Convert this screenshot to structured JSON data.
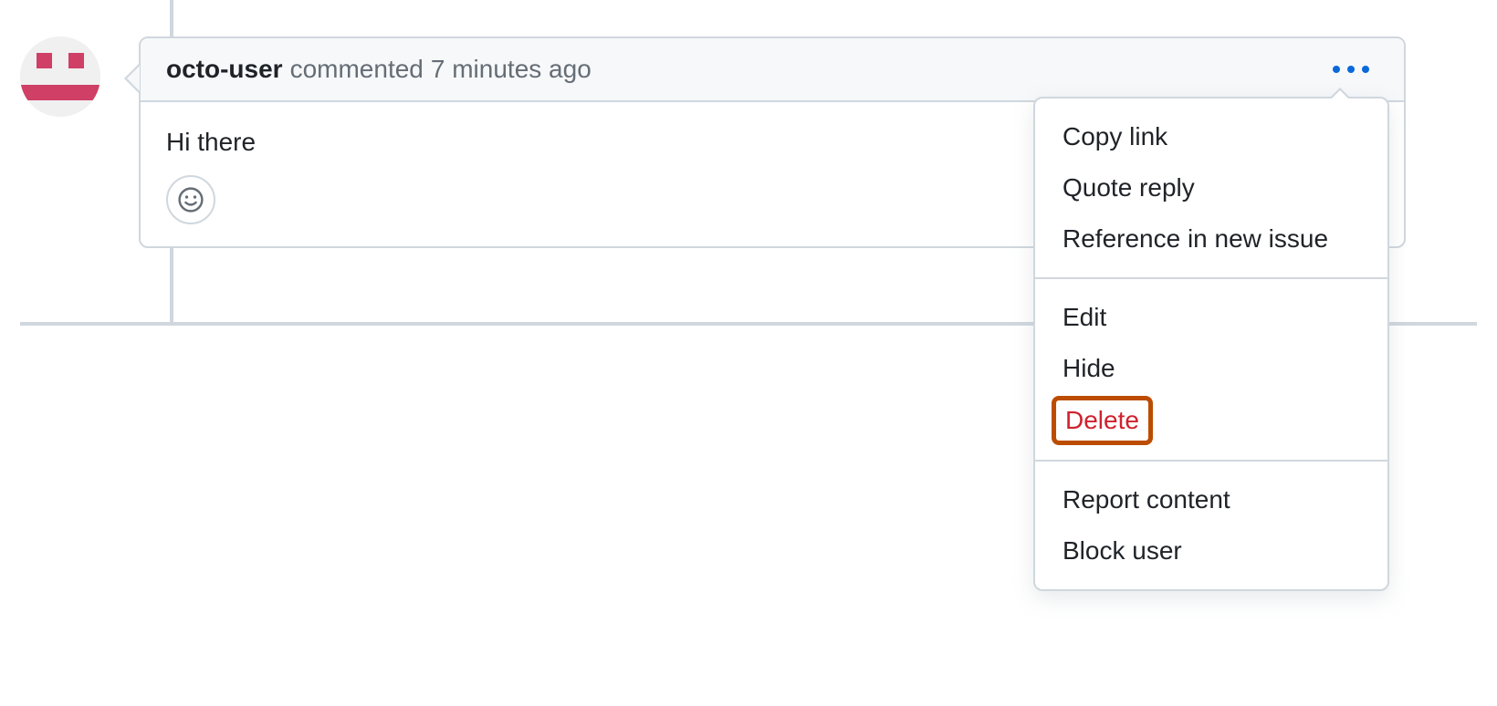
{
  "comment": {
    "author": "octo-user",
    "action_text": "commented",
    "timestamp": "7 minutes ago",
    "body": "Hi there"
  },
  "icons": {
    "kebab": "more-actions",
    "reaction": "smiley-face"
  },
  "menu": {
    "group1": {
      "copy_link": "Copy link",
      "quote_reply": "Quote reply",
      "reference_new_issue": "Reference in new issue"
    },
    "group2": {
      "edit": "Edit",
      "hide": "Hide",
      "delete": "Delete"
    },
    "group3": {
      "report_content": "Report content",
      "block_user": "Block user"
    }
  },
  "colors": {
    "accent": "#0969da",
    "danger": "#cf222e",
    "highlight_border": "#bc4c00",
    "avatar_pattern": "#cf3f66"
  }
}
